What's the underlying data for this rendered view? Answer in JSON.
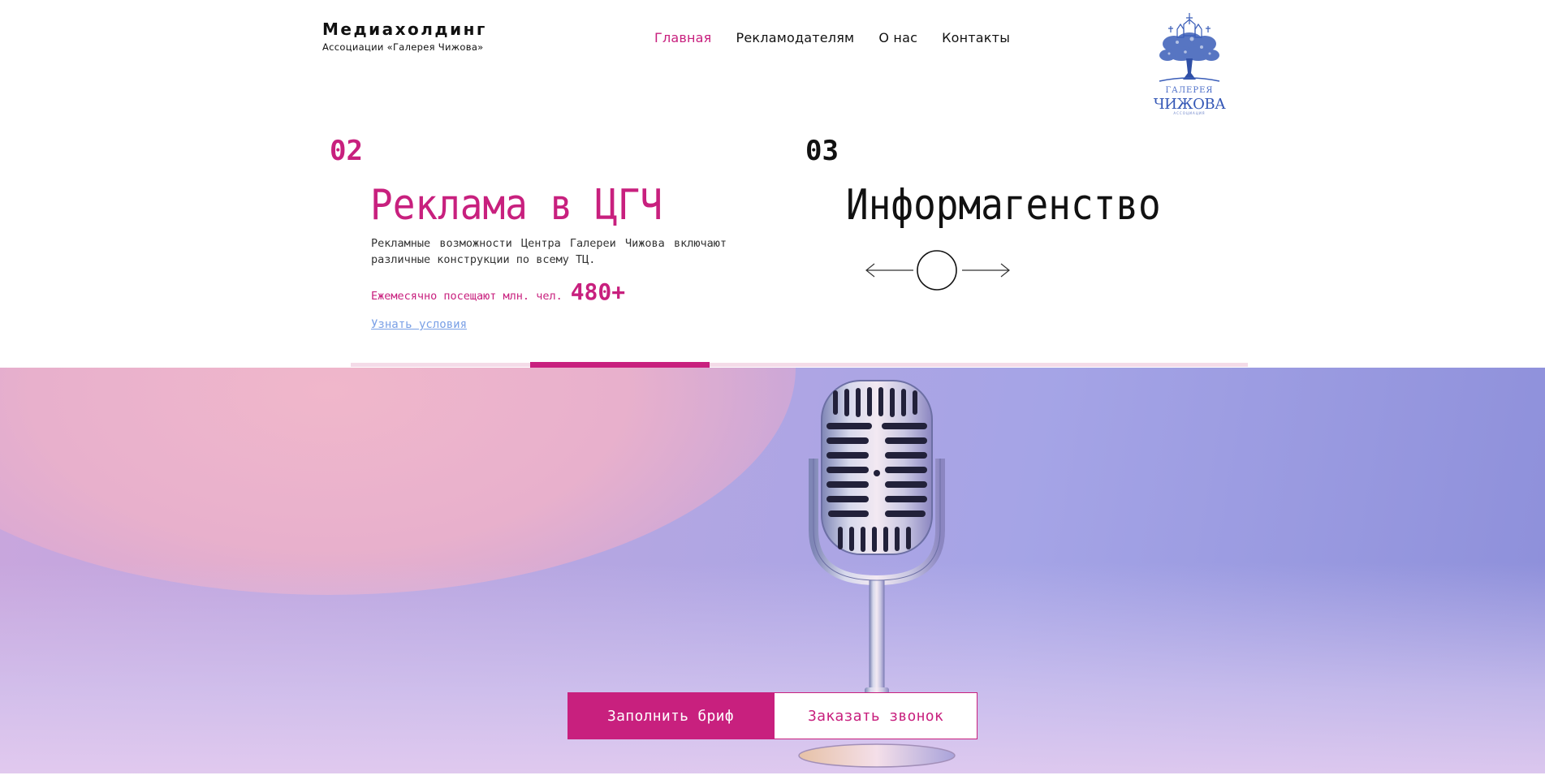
{
  "header": {
    "brand_title": "Медиахолдинг",
    "brand_subtitle": "Ассоциации «Галерея Чижова»",
    "nav": [
      {
        "label": "Главная",
        "active": true
      },
      {
        "label": "Рекламодателям",
        "active": false
      },
      {
        "label": "О нас",
        "active": false
      },
      {
        "label": "Контакты",
        "active": false
      }
    ],
    "logo": {
      "line1": "ГАЛЕРЕЯ",
      "line2": "ЧИЖОВА",
      "line3": "АССОЦИАЦИЯ"
    }
  },
  "slider": {
    "current": {
      "number": "02",
      "title": "Реклама в ЦГЧ",
      "description": "Рекламные возможности Центра Галереи Чижова включают различные конструкции по всему ТЦ.",
      "stat_label": "Ежемесячно посещают млн. чел.",
      "stat_value": "480+",
      "link": "Узнать условия"
    },
    "next": {
      "number": "03",
      "title": "Информагенство"
    },
    "progress_fraction": 0.2
  },
  "hero": {
    "primary_button": "Заполнить бриф",
    "secondary_button": "Заказать звонок"
  },
  "colors": {
    "accent": "#c8207e",
    "link": "#7aa0e6",
    "progress_track": "#f4dbe8"
  },
  "icons": [
    "arrow-left-icon",
    "arrow-right-icon",
    "slider-circle-icon",
    "microphone-image",
    "gallery-logo"
  ]
}
